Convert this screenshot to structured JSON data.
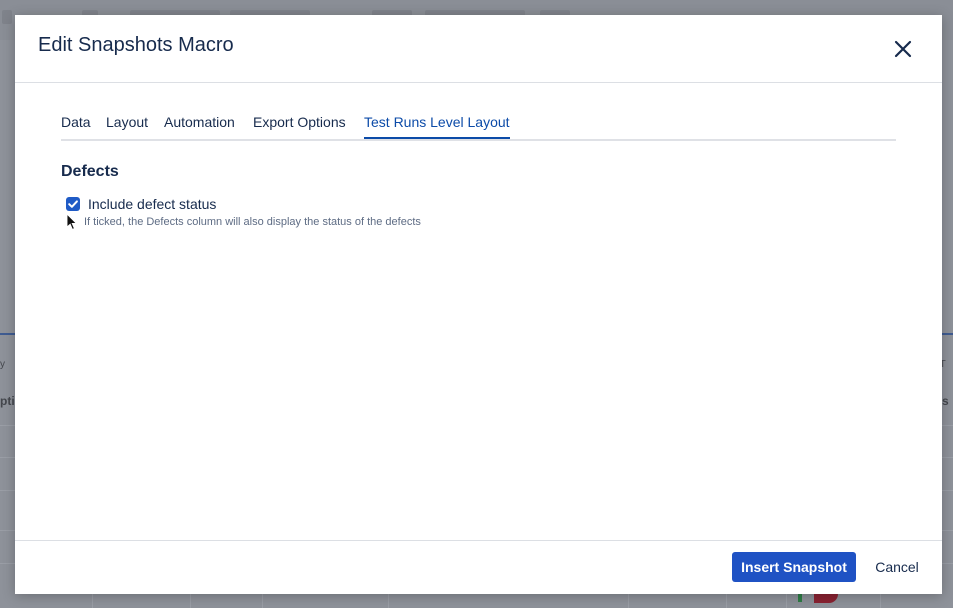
{
  "background": {
    "fragments": {
      "left_small": "y",
      "left_bold": "pti",
      "right_small": "y, T",
      "right_bold": "s"
    }
  },
  "dialog": {
    "title": "Edit Snapshots Macro",
    "close_icon": "close-icon",
    "tabs": [
      {
        "label": "Data",
        "active": false
      },
      {
        "label": "Layout",
        "active": false
      },
      {
        "label": "Automation",
        "active": false
      },
      {
        "label": "Export Options",
        "active": false
      },
      {
        "label": "Test Runs Level Layout",
        "active": true
      }
    ],
    "section": {
      "title": "Defects",
      "checkbox_label": "Include defect status",
      "checkbox_checked": true,
      "help_text": "If ticked, the Defects column will also display the status of the defects"
    },
    "footer": {
      "insert_label": "Insert Snapshot",
      "cancel_label": "Cancel"
    }
  },
  "colors": {
    "accent": "#1f52c4",
    "active_tab": "#0c4ba8",
    "text": "#172b4d",
    "overlay": "#8e929a"
  }
}
